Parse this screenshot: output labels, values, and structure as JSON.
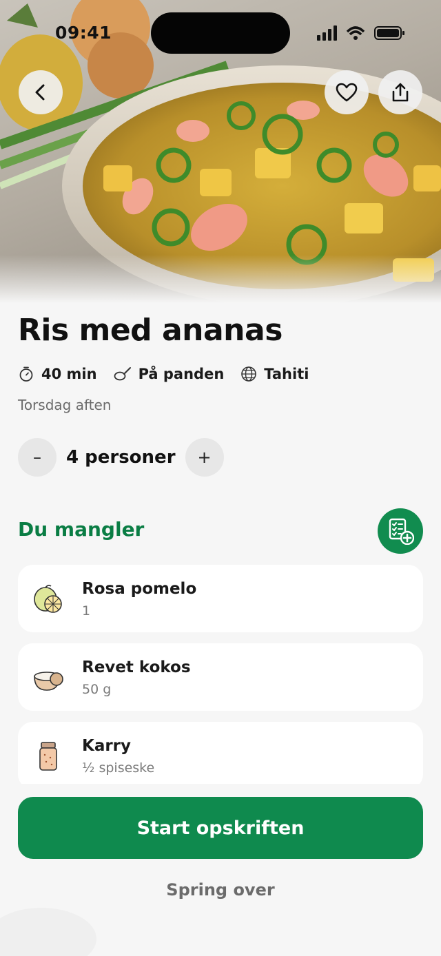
{
  "status_bar": {
    "time": "09:41"
  },
  "hero": {
    "image_alt": "pineapple-rice-dish-photo"
  },
  "recipe": {
    "title": "Ris med ananas",
    "meta": [
      {
        "icon": "timer-icon",
        "label": "40 min"
      },
      {
        "icon": "frying-pan-icon",
        "label": "På panden"
      },
      {
        "icon": "globe-icon",
        "label": "Tahiti"
      }
    ],
    "subtitle": "Torsdag aften"
  },
  "servings": {
    "minus_label": "–",
    "plus_label": "+",
    "label": "4 personer"
  },
  "missing": {
    "title": "Du mangler",
    "items": [
      {
        "name": "Rosa pomelo",
        "qty": "1",
        "icon": "pomelo-icon"
      },
      {
        "name": "Revet kokos",
        "qty": "50 g",
        "icon": "coconut-icon"
      },
      {
        "name": "Karry",
        "qty": "½ spiseske",
        "icon": "spice-jar-icon"
      }
    ]
  },
  "actions": {
    "start_label": "Start opskriften",
    "skip_label": "Spring over"
  },
  "colors": {
    "accent": "#0f8a4e",
    "accent_text": "#0a7d44",
    "background": "#f6f6f6"
  }
}
